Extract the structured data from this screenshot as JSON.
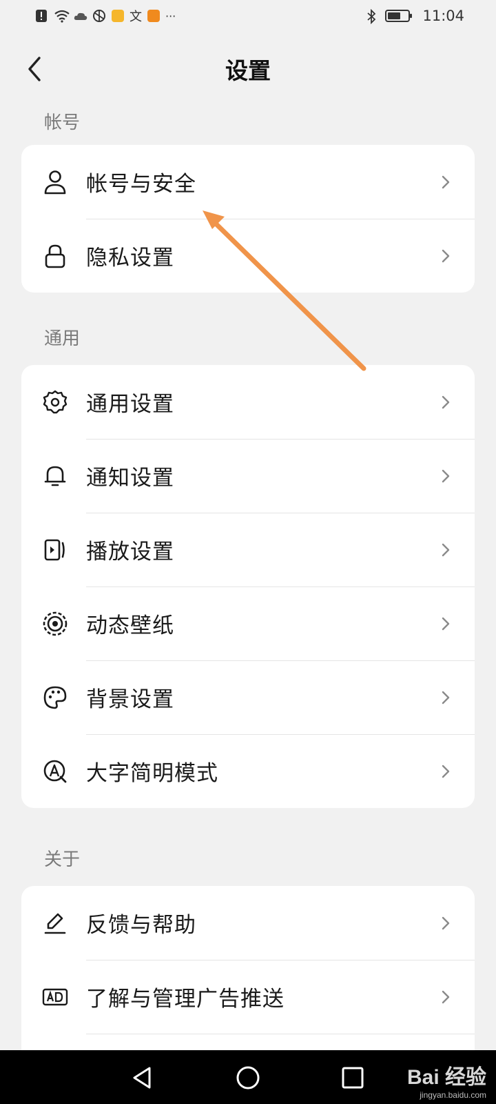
{
  "status_bar": {
    "time": "11:04",
    "more": "···",
    "app_glyph": "文"
  },
  "header": {
    "title": "设置"
  },
  "sections": [
    {
      "label": "帐号",
      "items": [
        {
          "label": "帐号与安全",
          "icon": "person-icon"
        },
        {
          "label": "隐私设置",
          "icon": "lock-icon"
        }
      ]
    },
    {
      "label": "通用",
      "items": [
        {
          "label": "通用设置",
          "icon": "gear-icon"
        },
        {
          "label": "通知设置",
          "icon": "bell-icon"
        },
        {
          "label": "播放设置",
          "icon": "play-card-icon"
        },
        {
          "label": "动态壁纸",
          "icon": "live-wallpaper-icon"
        },
        {
          "label": "背景设置",
          "icon": "palette-icon"
        },
        {
          "label": "大字简明模式",
          "icon": "large-text-icon"
        }
      ]
    },
    {
      "label": "关于",
      "items": [
        {
          "label": "反馈与帮助",
          "icon": "pencil-icon"
        },
        {
          "label": "了解与管理广告推送",
          "icon": "ad-icon"
        }
      ]
    }
  ],
  "watermark": {
    "brand": "Bai 经验",
    "url": "jingyan.baidu.com"
  },
  "colors": {
    "background": "#f1f1f1",
    "card": "#ffffff",
    "annotation_arrow": "#f0944a"
  }
}
